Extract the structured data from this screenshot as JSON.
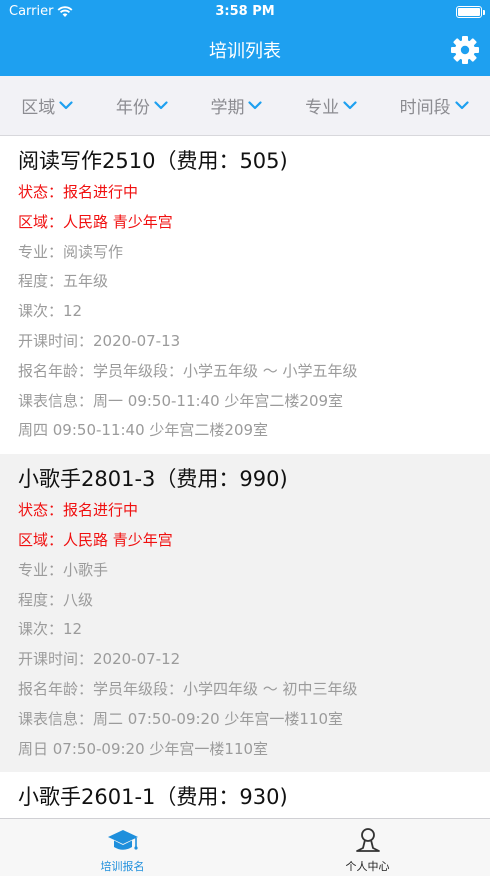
{
  "status_bar": {
    "carrier": "Carrier",
    "time": "3:58 PM"
  },
  "nav": {
    "title": "培训列表"
  },
  "filters": [
    {
      "label": "区域"
    },
    {
      "label": "年份"
    },
    {
      "label": "学期"
    },
    {
      "label": "专业"
    },
    {
      "label": "时间段"
    }
  ],
  "courses": [
    {
      "title": "阅读写作2510（费用：505)",
      "status": "状态：报名进行中",
      "area": "区域：人民路 青少年宫",
      "major": "专业：阅读写作",
      "level": "程度：五年级",
      "lessons": "课次：12",
      "start": "开课时间：2020-07-13",
      "age": "报名年龄：学员年级段：小学五年级 ～ 小学五年级",
      "schedule1": "课表信息：周一 09:50-11:40 少年宫二楼209室",
      "schedule2": "周四 09:50-11:40 少年宫二楼209室"
    },
    {
      "title": "小歌手2801-3（费用：990)",
      "status": "状态：报名进行中",
      "area": "区域：人民路 青少年宫",
      "major": "专业：小歌手",
      "level": "程度：八级",
      "lessons": "课次：12",
      "start": "开课时间：2020-07-12",
      "age": "报名年龄：学员年级段：小学四年级 ～ 初中三年级",
      "schedule1": "课表信息：周二 07:50-09:20 少年宫一楼110室",
      "schedule2": "周日 07:50-09:20 少年宫一楼110室"
    },
    {
      "title": "小歌手2601-1（费用：930)"
    }
  ],
  "tabs": [
    {
      "label": "培训报名",
      "icon": "graduation-cap-icon"
    },
    {
      "label": "个人中心",
      "icon": "person-icon"
    }
  ],
  "colors": {
    "accent": "#1ea0f0",
    "status_red": "#f01010",
    "tab_active": "#1e8fdc"
  }
}
